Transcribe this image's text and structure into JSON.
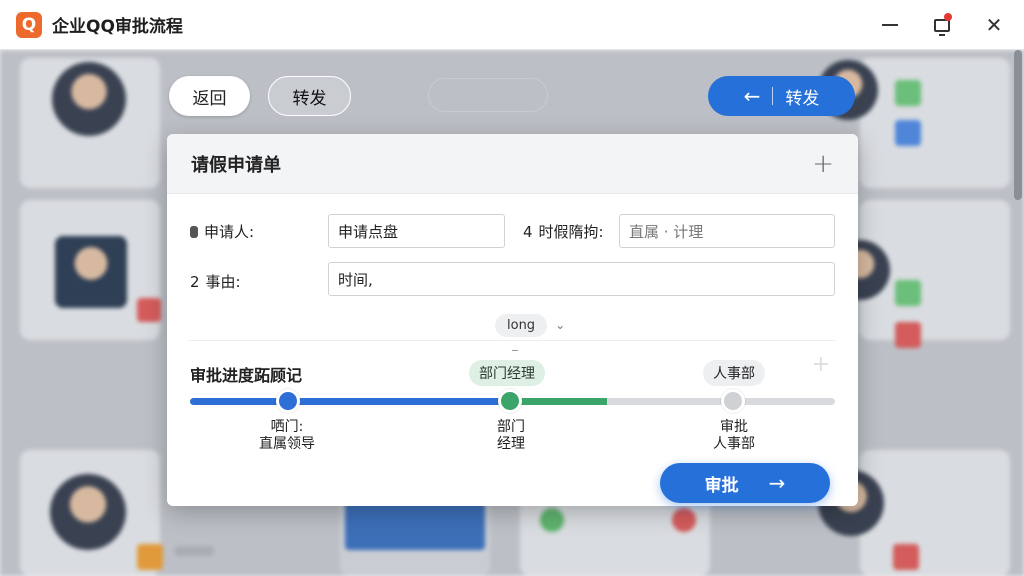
{
  "window": {
    "logo_text": "Q",
    "title": "企业QQ审批流程",
    "minimize_label": "",
    "close_label": "✕"
  },
  "toolbar": {
    "back_label": "返回",
    "forward_label": "转发",
    "forward_primary_label": "转发",
    "forward_primary_arrow": "←"
  },
  "modal": {
    "title": "请假申请单",
    "expand_icon": "+",
    "fields": {
      "applicant_label": "申请人:",
      "applicant_value": "申请点盘",
      "time_label_prefix": "4",
      "time_label": "时假隋拘:",
      "time_value": "直属 · 计理",
      "reason_label_prefix": "2",
      "reason_label": "事由:",
      "reason_value": "时间,"
    },
    "dropdown": {
      "value": "long",
      "chevron": "⌄"
    },
    "progress": {
      "title": "审批进度跖顾记",
      "completed_fraction": 0.5,
      "steps": [
        {
          "tag": "",
          "label_line1": "哂门:",
          "label_line2": "直属领导",
          "status": "done"
        },
        {
          "tag": "部门经理",
          "label_line1": "部门",
          "label_line2": "经理",
          "status": "current"
        },
        {
          "tag": "人事部",
          "label_line1": "审批",
          "label_line2": "人事部",
          "status": "pending"
        }
      ]
    },
    "approve_label": "审批",
    "approve_arrow": "→"
  },
  "colors": {
    "primary": "#2570d9",
    "success": "#3aa46a",
    "pending": "#cfd1d4",
    "logo": "#ee6a2c"
  }
}
